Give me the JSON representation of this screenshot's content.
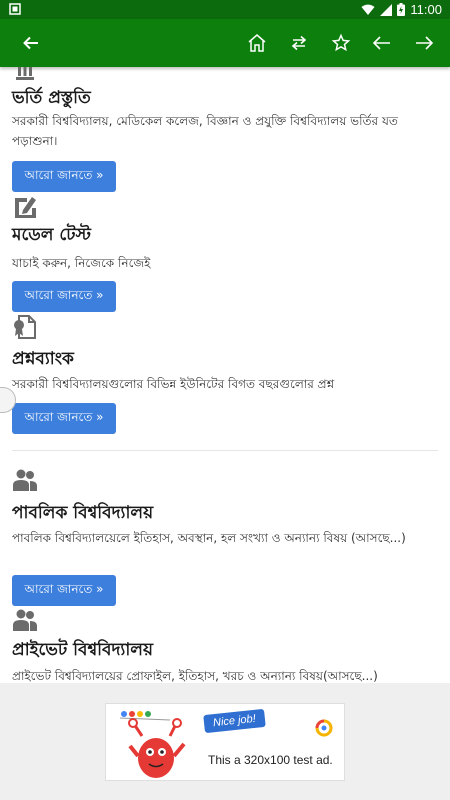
{
  "status_bar": {
    "time": "11:00"
  },
  "colors": {
    "toolbar": "#0c7f0c",
    "status_bar": "#0c6b0c",
    "button": "#3d7fdd"
  },
  "toolbar": {
    "icons": [
      "back-arrow-icon",
      "home-icon",
      "swap-icon",
      "star-icon",
      "arrow-left-icon",
      "arrow-right-icon"
    ]
  },
  "sections": [
    {
      "title": "ভর্তি প্রস্তুতি",
      "description": "সরকারী বিশ্ববিদ্যালয়, মেডিকেল কলেজ, বিজ্ঞান ও প্রযুক্তি বিশ্ববিদ্যালয়  ভর্তির যত পড়াশুনা।",
      "button": "আরো জানতে »",
      "icon": "pillar-icon"
    },
    {
      "title": "মডেল টেস্ট",
      "description": "যাচাই করুন, নিজেকে নিজেই",
      "button": "আরো জানতে »",
      "icon": "pencil-edit-icon"
    },
    {
      "title": "প্রশ্নব্যাংক",
      "description": "সরকারী বিশ্ববিদ্যালয়গুলোর বিভিন্ন ইউনিটের বিগত বছরগুলোর প্রশ্ন",
      "button": "আরো জানতে »",
      "icon": "certificate-icon"
    },
    {
      "title": "পাবলিক বিশ্ববিদ্যালয়",
      "description": "পাবলিক বিশ্ববিদ্যালয়েলে ইতিহাস, অবস্থান, হল সংখ্যা ও অন্যান্য বিষয় (আসছে...)",
      "button": "আরো জানতে »",
      "icon": "users-group-icon"
    },
    {
      "title": "প্রাইভেট বিশ্ববিদ্যালয়",
      "description": "প্রাইভেট বিশ্ববিদ্যালয়ের প্রোফাইল, ইতিহাস, খরচ ও অন্যান্য বিষয়(আসছে...)",
      "icon": "users-group-icon"
    }
  ],
  "ad": {
    "bubble": "Nice job!",
    "text": "This a 320x100 test ad."
  }
}
